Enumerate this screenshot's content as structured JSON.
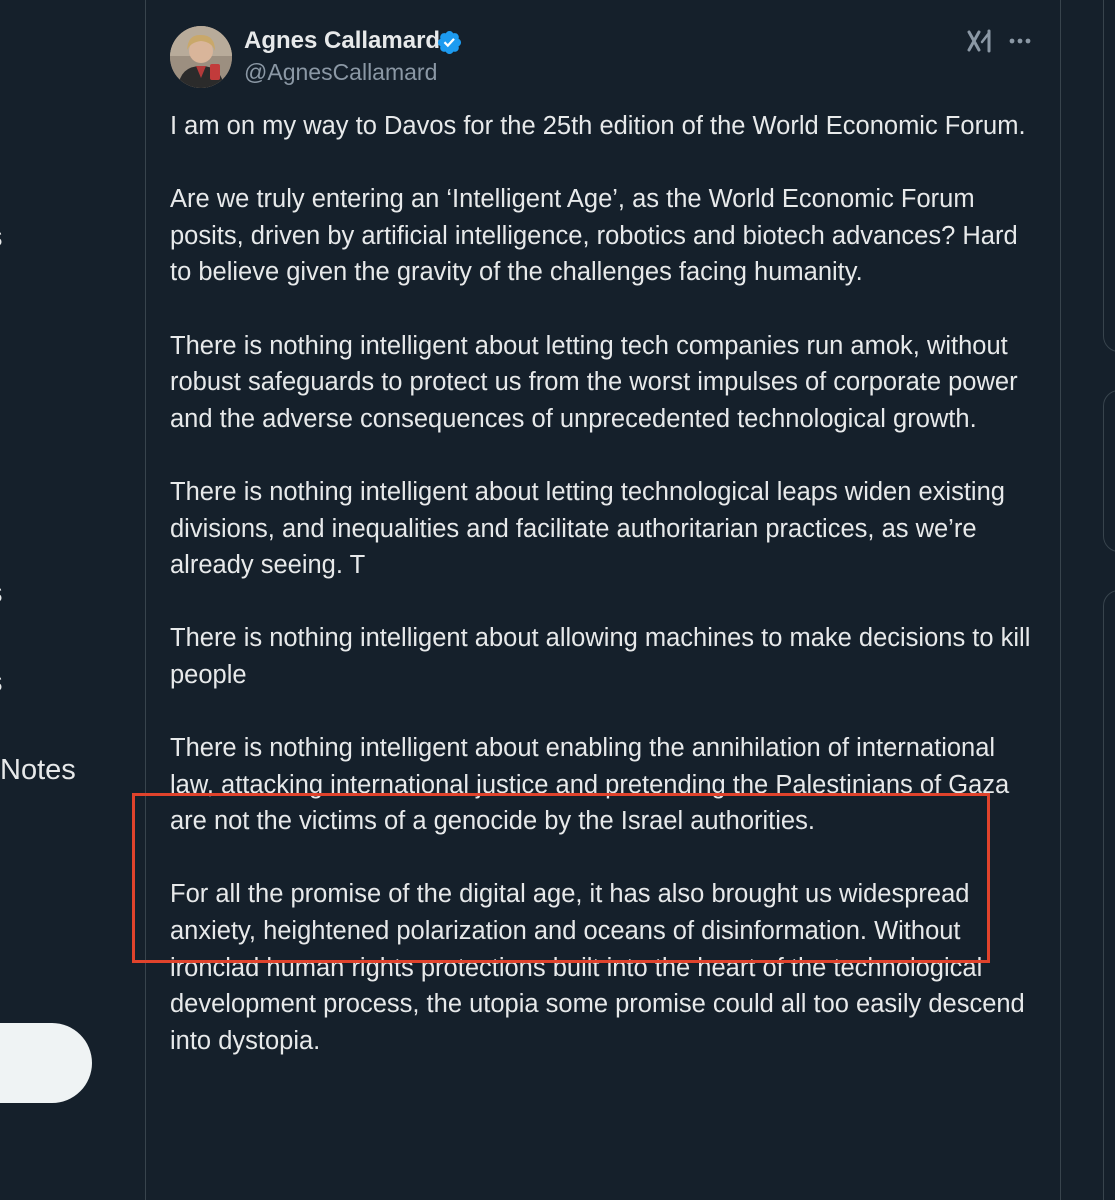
{
  "sidebar": {
    "items": [
      {
        "label": "s"
      },
      {
        "label": "s"
      },
      {
        "label": "s"
      },
      {
        "label": "Notes"
      }
    ]
  },
  "tweet": {
    "author_name": "Agnes Callamard",
    "author_handle": "@AgnesCallamard",
    "paragraphs": [
      "I am on my way to Davos for the 25th edition of the World Economic Forum.",
      "Are we truly entering an ‘Intelligent Age’, as the World Economic Forum posits, driven by artificial intelligence, robotics and biotech advances? Hard to believe given the gravity of the challenges facing humanity.",
      "There is nothing intelligent about letting tech companies run amok, without robust safeguards to protect us from the worst impulses of corporate power and the adverse consequences of unprecedented technological growth.",
      "There is nothing intelligent about letting technological leaps widen existing divisions, and inequalities and facilitate authoritarian practices, as we’re already seeing. T",
      "There is nothing intelligent about allowing machines to make decisions to kill people",
      "There is nothing intelligent about enabling the annihilation of international law, attacking international justice and pretending the Palestinians of Gaza are not the victims of a genocide by the Israel authorities.",
      "For all the promise of the digital age, it has also brought us widespread anxiety, heightened polarization and oceans of disinformation. Without ironclad human rights protections built into the heart of the technological development process, the utopia some promise could all too easily descend into dystopia."
    ]
  },
  "icons": {
    "verified": "verified-badge-icon",
    "grok": "grok-icon",
    "more": "more-options-icon"
  },
  "colors": {
    "background": "#15202b",
    "text": "#e7e9ea",
    "secondary_text": "#8b98a5",
    "verified_blue": "#1d9bf0",
    "highlight_border": "#e0432c",
    "divider": "#38444d"
  }
}
